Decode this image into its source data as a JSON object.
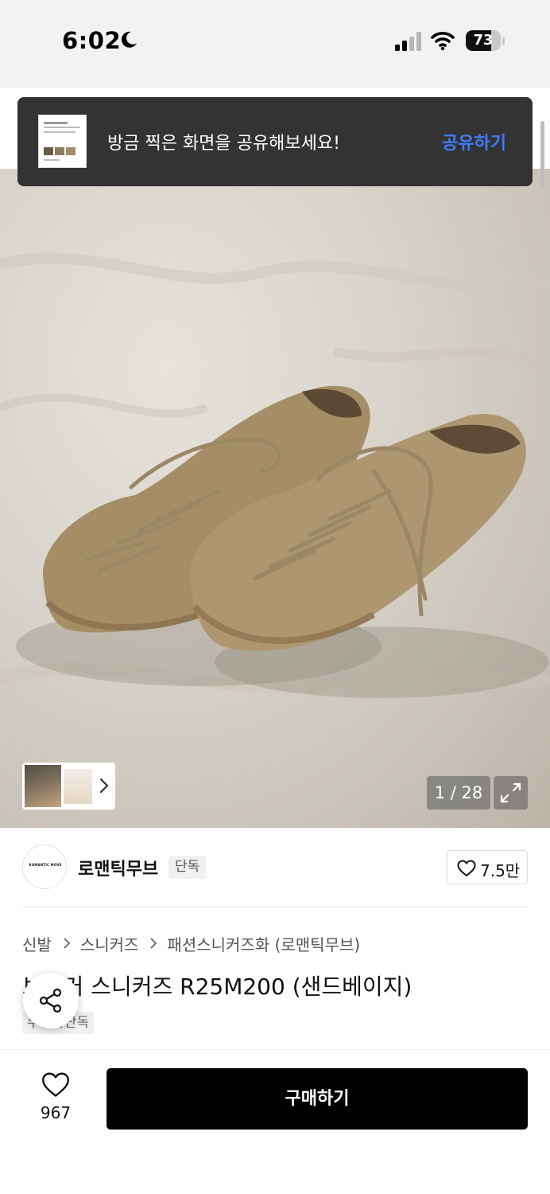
{
  "status_bar": {
    "time": "6:02",
    "battery_percent": "73",
    "battery_level": 0.73
  },
  "toast": {
    "message": "방금 찍은 화면을 공유해보세요!",
    "action": "공유하기"
  },
  "gallery": {
    "counter": "1 / 28"
  },
  "brand": {
    "logo_text": "ROMANTIC MOVE",
    "name": "로맨틱무브",
    "exclusive_badge": "단독",
    "likes": "7.5만"
  },
  "breadcrumb": [
    "신발",
    "스니커즈",
    "패션스니커즈화 (로맨틱무브)"
  ],
  "product": {
    "title": "브로커 스니커즈 R25M200 (샌드베이지)",
    "badge": "무신사단독"
  },
  "bottom_bar": {
    "wish_count": "967",
    "buy_label": "구매하기"
  },
  "colors": {
    "toast_bg": "#333333",
    "toast_action": "#3d7bff",
    "buy_bg": "#000000"
  },
  "icons": [
    "moon-icon",
    "cellular-signal-icon",
    "wifi-icon",
    "battery-icon",
    "chevron-right-icon",
    "expand-icon",
    "heart-icon",
    "share-icon"
  ]
}
